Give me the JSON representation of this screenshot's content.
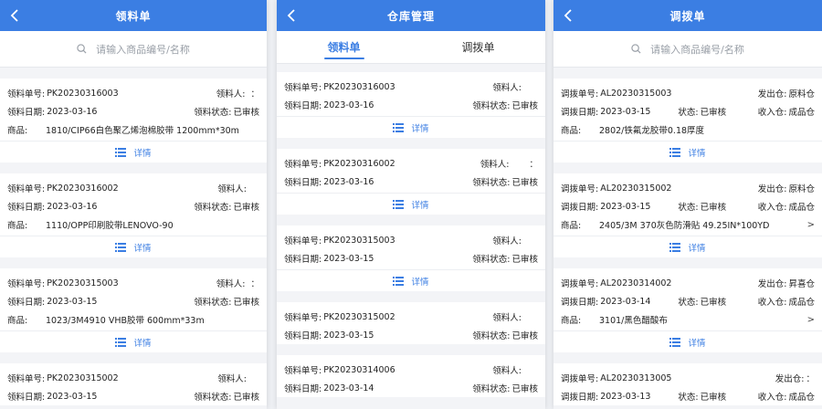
{
  "screens": [
    {
      "title": "领料单",
      "search_placeholder": "请输入商品编号/名称",
      "cards": [
        {
          "no_label": "领料单号:",
          "no": "PK20230316003",
          "person_label": "领料人:",
          "person": "：",
          "date_label": "领料日期:",
          "date": "2023-03-16",
          "status_label": "领料状态:",
          "status": "已审核",
          "goods_label": "商品:",
          "goods": "1810/CIP66白色聚乙烯泡棉胶带 1200mm*30m",
          "detail": "详情"
        },
        {
          "no_label": "领料单号:",
          "no": "PK20230316002",
          "person_label": "领料人:",
          "person": "",
          "date_label": "领料日期:",
          "date": "2023-03-16",
          "status_label": "领料状态:",
          "status": "已审核",
          "goods_label": "商品:",
          "goods": "1110/OPP印刷胶带LENOVO-90",
          "detail": "详情"
        },
        {
          "no_label": "领料单号:",
          "no": "PK20230315003",
          "person_label": "领料人:",
          "person": "：",
          "date_label": "领料日期:",
          "date": "2023-03-15",
          "status_label": "领料状态:",
          "status": "已审核",
          "goods_label": "商品:",
          "goods": "1023/3M4910 VHB胶带 600mm*33m",
          "detail": "详情"
        },
        {
          "no_label": "领料单号:",
          "no": "PK20230315002",
          "person_label": "领料人:",
          "person": "",
          "date_label": "领料日期:",
          "date": "2023-03-15",
          "status_label": "领料状态:",
          "status": "已审核",
          "goods_label": "",
          "goods": "",
          "detail": ""
        }
      ]
    },
    {
      "title": "仓库管理",
      "tabs": [
        "领料单",
        "调拨单"
      ],
      "cards": [
        {
          "no_label": "领料单号:",
          "no": "PK20230316003",
          "person_label": "领料人:",
          "person": "",
          "date_label": "领料日期:",
          "date": "2023-03-16",
          "status_label": "领料状态:",
          "status": "已审核",
          "detail": "详情"
        },
        {
          "no_label": "领料单号:",
          "no": "PK20230316002",
          "person_label": "领料人:",
          "person": "：",
          "date_label": "领料日期:",
          "date": "2023-03-16",
          "status_label": "领料状态:",
          "status": "已审核",
          "detail": "详情"
        },
        {
          "no_label": "领料单号:",
          "no": "PK20230315003",
          "person_label": "领料人:",
          "person": "",
          "date_label": "领料日期:",
          "date": "2023-03-15",
          "status_label": "领料状态:",
          "status": "已审核",
          "detail": "详情"
        },
        {
          "no_label": "领料单号:",
          "no": "PK20230315002",
          "person_label": "领料人:",
          "person": "",
          "date_label": "领料日期:",
          "date": "2023-03-15",
          "status_label": "领料状态:",
          "status": "已审核",
          "detail": "详情"
        },
        {
          "no_label": "领料单号:",
          "no": "PK20230314006",
          "person_label": "领料人:",
          "person": "",
          "date_label": "领料日期:",
          "date": "2023-03-14",
          "status_label": "领料状态:",
          "status": "已审核",
          "detail": ""
        }
      ]
    },
    {
      "title": "调拨单",
      "search_placeholder": "请输入商品编号/名称",
      "cards": [
        {
          "no_label": "调拨单号:",
          "no": "AL20230315003",
          "from_label": "发出仓:",
          "from": "原料仓",
          "date_label": "调拨日期:",
          "date": "2023-03-15",
          "status_label": "状态:",
          "status": "已审核",
          "to_label": "收入仓:",
          "to": "成品仓",
          "goods_label": "商品:",
          "goods": "2802/铁氟龙胶带0.18厚度",
          "has_more": false,
          "detail": "详情"
        },
        {
          "no_label": "调拨单号:",
          "no": "AL20230315002",
          "from_label": "发出仓:",
          "from": "原料仓",
          "date_label": "调拨日期:",
          "date": "2023-03-15",
          "status_label": "状态:",
          "status": "已审核",
          "to_label": "收入仓:",
          "to": "成品仓",
          "goods_label": "商品:",
          "goods": "2405/3M 370灰色防滑贴 49.25IN*100YD",
          "has_more": true,
          "detail": "详情"
        },
        {
          "no_label": "调拨单号:",
          "no": "AL20230314002",
          "from_label": "发出仓:",
          "from": "昇喜仓",
          "date_label": "调拨日期:",
          "date": "2023-03-14",
          "status_label": "状态:",
          "status": "已审核",
          "to_label": "收入仓:",
          "to": "成品仓",
          "goods_label": "商品:",
          "goods": "3101/黑色醋酸布",
          "has_more": true,
          "detail": "详情"
        },
        {
          "no_label": "调拨单号:",
          "no": "AL20230313005",
          "from_label": "发出仓:",
          "from": "：",
          "date_label": "调拨日期:",
          "date": "2023-03-13",
          "status_label": "状态:",
          "status": "已审核",
          "to_label": "收入仓:",
          "to": "成品仓",
          "goods_label": "",
          "goods": "",
          "has_more": false,
          "detail": ""
        }
      ]
    }
  ],
  "more_glyph": ">",
  "colors": {
    "accent": "#3b7ee3",
    "background": "#f3f4f7"
  }
}
